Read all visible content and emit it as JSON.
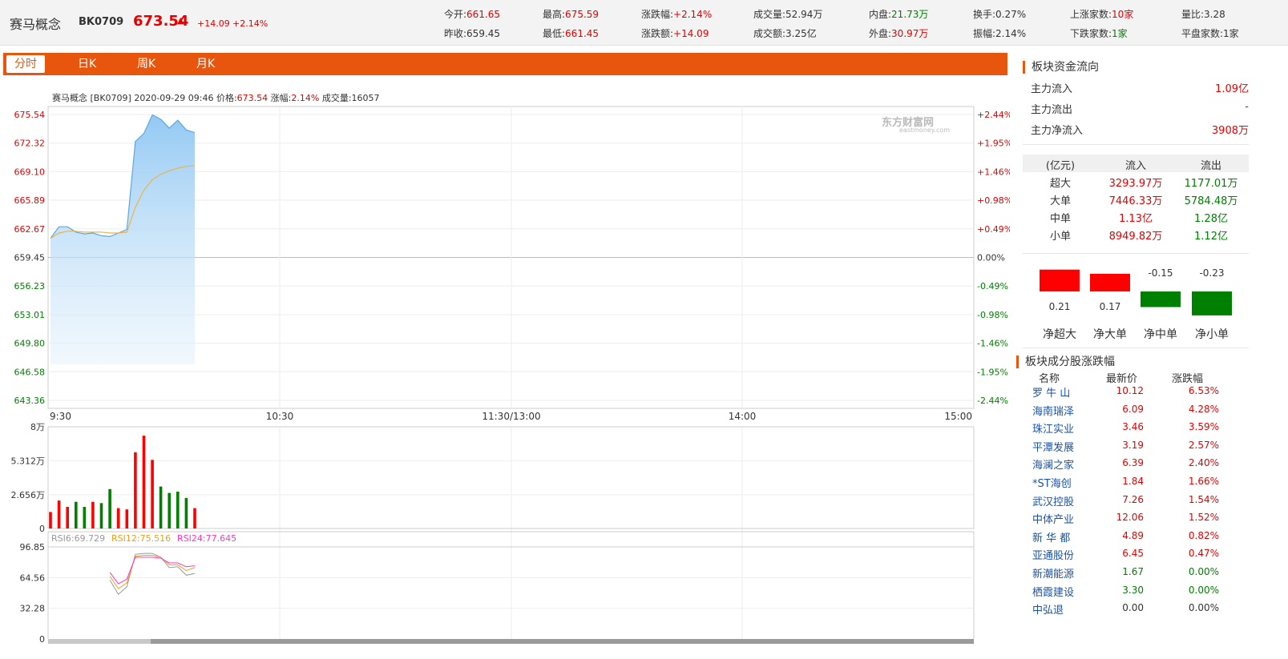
{
  "header": {
    "name": "赛马概念",
    "code": "BK0709",
    "price": "673.54",
    "arrow": "▲",
    "change": "+14.09",
    "change_pct": "+2.14%",
    "stats": [
      {
        "label": "今开:",
        "value": "661.65",
        "color": "red"
      },
      {
        "label": "昨收:",
        "value": "659.45",
        "color": "dark"
      },
      {
        "label": "最高:",
        "value": "675.59",
        "color": "red"
      },
      {
        "label": "最低:",
        "value": "661.45",
        "color": "red"
      },
      {
        "label": "涨跌幅:",
        "value": "+2.14%",
        "color": "red"
      },
      {
        "label": "涨跌额:",
        "value": "+14.09",
        "color": "red"
      },
      {
        "label": "成交量:",
        "value": "52.94万",
        "color": "dark"
      },
      {
        "label": "成交额:",
        "value": "3.25亿",
        "color": "dark"
      },
      {
        "label": "内盘:",
        "value": "21.73万",
        "color": "green"
      },
      {
        "label": "外盘:",
        "value": "30.97万",
        "color": "red"
      },
      {
        "label": "换手:",
        "value": "0.27%",
        "color": "dark"
      },
      {
        "label": "振幅:",
        "value": "2.14%",
        "color": "dark"
      },
      {
        "label": "上涨家数:",
        "value": "10家",
        "color": "red"
      },
      {
        "label": "下跌家数:",
        "value": "1家",
        "color": "green"
      },
      {
        "label": "量比:",
        "value": "3.28",
        "color": "dark"
      },
      {
        "label": "平盘家数:",
        "value": "1家",
        "color": "dark"
      }
    ]
  },
  "tabs": [
    {
      "label": "分时",
      "active": true
    },
    {
      "label": "日K",
      "active": false
    },
    {
      "label": "周K",
      "active": false
    },
    {
      "label": "月K",
      "active": false
    }
  ],
  "chart_info": {
    "prefix": "赛马概念 [BK0709]  2020-09-29 09:46  价格:",
    "price": "673.54",
    "chg_label": "涨幅:",
    "chg": "2.14%",
    "vol_label": "成交量:",
    "vol": "16057"
  },
  "watermark": {
    "cn": "东方财富网",
    "en": "eastmoney.com"
  },
  "chart_data": {
    "type": "line",
    "price_axis": {
      "left_ticks": [
        "675.54",
        "672.32",
        "669.10",
        "665.89",
        "662.67",
        "659.45",
        "656.23",
        "653.01",
        "649.80",
        "646.58",
        "643.36"
      ],
      "right_ticks": [
        "+2.44%",
        "+1.95%",
        "+1.46%",
        "+0.98%",
        "+0.49%",
        "0.00%",
        "-0.49%",
        "-0.98%",
        "-1.46%",
        "-1.95%",
        "-2.44%"
      ],
      "ylim": [
        643.36,
        675.54
      ],
      "base": 659.45
    },
    "time_axis": [
      "9:30",
      "10:30",
      "11:30/13:00",
      "14:00",
      "15:00"
    ],
    "total_minutes": 240,
    "price_series": {
      "name": "价格",
      "values": [
        661.6,
        662.9,
        662.9,
        662.3,
        662.1,
        662.2,
        661.9,
        661.8,
        662.2,
        662.6,
        672.5,
        673.4,
        675.5,
        675.0,
        674.0,
        674.9,
        673.8,
        673.5
      ]
    },
    "avg_series": {
      "name": "均价",
      "values": [
        661.6,
        662.2,
        662.4,
        662.4,
        662.3,
        662.3,
        662.3,
        662.2,
        662.2,
        662.3,
        665.1,
        667.0,
        668.2,
        668.8,
        669.2,
        669.5,
        669.7,
        669.8
      ]
    },
    "volume": {
      "ticks": [
        "8万",
        "5.312万",
        "2.656万",
        "0"
      ],
      "ylim": [
        0,
        80000
      ],
      "values": [
        13000,
        22000,
        17000,
        21000,
        17000,
        21000,
        20000,
        31000,
        16000,
        15000,
        60000,
        73000,
        54000,
        33000,
        28000,
        29000,
        24000,
        16000
      ],
      "colors": [
        "red",
        "red",
        "red",
        "green",
        "green",
        "red",
        "green",
        "green",
        "red",
        "red",
        "red",
        "red",
        "red",
        "green",
        "green",
        "green",
        "green",
        "red"
      ]
    },
    "rsi": {
      "labels": [
        "RSI6:69.729",
        "RSI12:75.516",
        "RSI24:77.645"
      ],
      "ticks": [
        "96.85",
        "64.56",
        "32.28",
        "0"
      ],
      "ylim": [
        0,
        96.85
      ],
      "rsi6": [
        null,
        null,
        null,
        null,
        null,
        null,
        null,
        62,
        47,
        55,
        89,
        90,
        90,
        86,
        75,
        76,
        67,
        69
      ],
      "rsi12": [
        null,
        null,
        null,
        null,
        null,
        null,
        null,
        66,
        53,
        59,
        87,
        88,
        88,
        86,
        78,
        78,
        72,
        75
      ],
      "rsi24": [
        null,
        null,
        null,
        null,
        null,
        null,
        null,
        70,
        58,
        63,
        86,
        86,
        86,
        85,
        80,
        80,
        76,
        77
      ]
    }
  },
  "fund_flow": {
    "title": "板块资金流向",
    "rows": [
      {
        "label": "主力流入",
        "value": "1.09亿"
      },
      {
        "label": "主力流出",
        "value": "-"
      },
      {
        "label": "主力净流入",
        "value": "3908万"
      }
    ],
    "table_head": [
      "(亿元)",
      "流入",
      "流出"
    ],
    "table": [
      {
        "label": "超大",
        "in": "3293.97万",
        "out": "1177.01万"
      },
      {
        "label": "大单",
        "in": "7446.33万",
        "out": "5784.48万"
      },
      {
        "label": "中单",
        "in": "1.13亿",
        "out": "1.28亿"
      },
      {
        "label": "小单",
        "in": "8949.82万",
        "out": "1.12亿"
      }
    ],
    "net_bars": [
      {
        "label": "净超大",
        "value": 0.21,
        "text": "0.21"
      },
      {
        "label": "净大单",
        "value": 0.17,
        "text": "0.17"
      },
      {
        "label": "净中单",
        "value": -0.15,
        "text": "-0.15"
      },
      {
        "label": "净小单",
        "value": -0.23,
        "text": "-0.23"
      }
    ]
  },
  "constituents": {
    "title": "板块成分股涨跌幅",
    "head": [
      "名称",
      "最新价",
      "涨跌幅"
    ],
    "rows": [
      {
        "name": "罗 牛 山",
        "price": "10.12",
        "pct": "6.53%",
        "color": "red"
      },
      {
        "name": "海南瑞泽",
        "price": "6.09",
        "pct": "4.28%",
        "color": "red"
      },
      {
        "name": "珠江实业",
        "price": "3.46",
        "pct": "3.59%",
        "color": "red"
      },
      {
        "name": "平潭发展",
        "price": "3.19",
        "pct": "2.57%",
        "color": "red"
      },
      {
        "name": "海澜之家",
        "price": "6.39",
        "pct": "2.40%",
        "color": "red"
      },
      {
        "name": "*ST海创",
        "price": "1.84",
        "pct": "1.66%",
        "color": "red"
      },
      {
        "name": "武汉控股",
        "price": "7.26",
        "pct": "1.54%",
        "color": "red"
      },
      {
        "name": "中体产业",
        "price": "12.06",
        "pct": "1.52%",
        "color": "red"
      },
      {
        "name": "新 华 都",
        "price": "4.89",
        "pct": "0.82%",
        "color": "red"
      },
      {
        "name": "亚通股份",
        "price": "6.45",
        "pct": "0.47%",
        "color": "red"
      },
      {
        "name": "新潮能源",
        "price": "1.67",
        "pct": "0.00%",
        "color": "green"
      },
      {
        "name": "栖霞建设",
        "price": "3.30",
        "pct": "0.00%",
        "color": "green"
      },
      {
        "name": "中弘退",
        "price": "0.00",
        "pct": "0.00%",
        "color": "dark"
      }
    ]
  }
}
